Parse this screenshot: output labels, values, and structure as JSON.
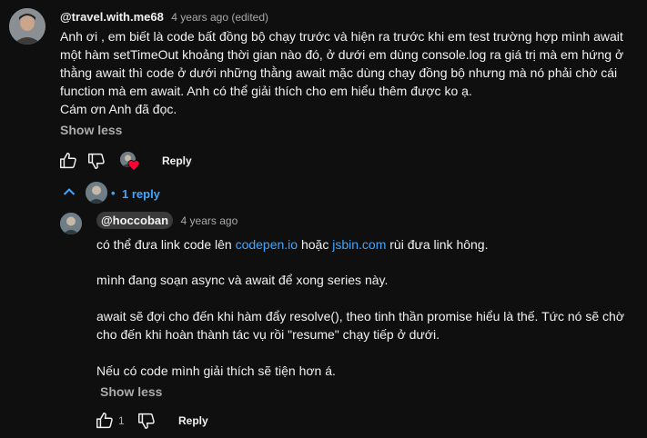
{
  "comment": {
    "author": "@travel.with.me68",
    "time": "4 years ago (edited)",
    "lines": [
      "Anh ơi , em biết là code bất đồng bộ chạy trước và hiện ra trước khi em test trường hợp mình await",
      "một hàm setTimeOut khoảng thời gian nào đó, ở dưới em dùng console.log ra giá trị mà em hứng ở",
      "thằng await thì code ở dưới những thằng await mặc dùng chạy đồng bộ nhưng mà nó phải chờ cái",
      "function mà em await. Anh có thể giải thích cho em hiểu thêm được ko ạ.",
      "Cám ơn Anh đã đọc."
    ],
    "show_less": "Show less",
    "reply_label": "Reply"
  },
  "replies_toggle": {
    "label": "1 reply",
    "separator": "•"
  },
  "reply": {
    "author": "@hoccoban",
    "time": "4 years ago",
    "line1_prefix": "có thể đưa link code lên ",
    "link1": "codepen.io",
    "line1_middle": " hoặc ",
    "link2": "jsbin.com",
    "line1_suffix": " rùi đưa link hông.",
    "para2": "mình đang soạn async và await để xong series này.",
    "para3_line1": "await sẽ đợi cho đến khi hàm đẩy resolve(), theo tinh thần promise hiểu là thế. Tức nó sẽ chờ",
    "para3_line2": "cho đến khi hoàn thành tác vụ rồi \"resume\" chạy tiếp ở dưới.",
    "para4": "Nếu có code mình giải thích sẽ tiện hơn á.",
    "show_less": "Show less",
    "like_count": "1",
    "reply_label": "Reply"
  },
  "colors": {
    "background": "#0f0f0f",
    "link": "#3ea6ff",
    "heart": "#ff0033"
  }
}
